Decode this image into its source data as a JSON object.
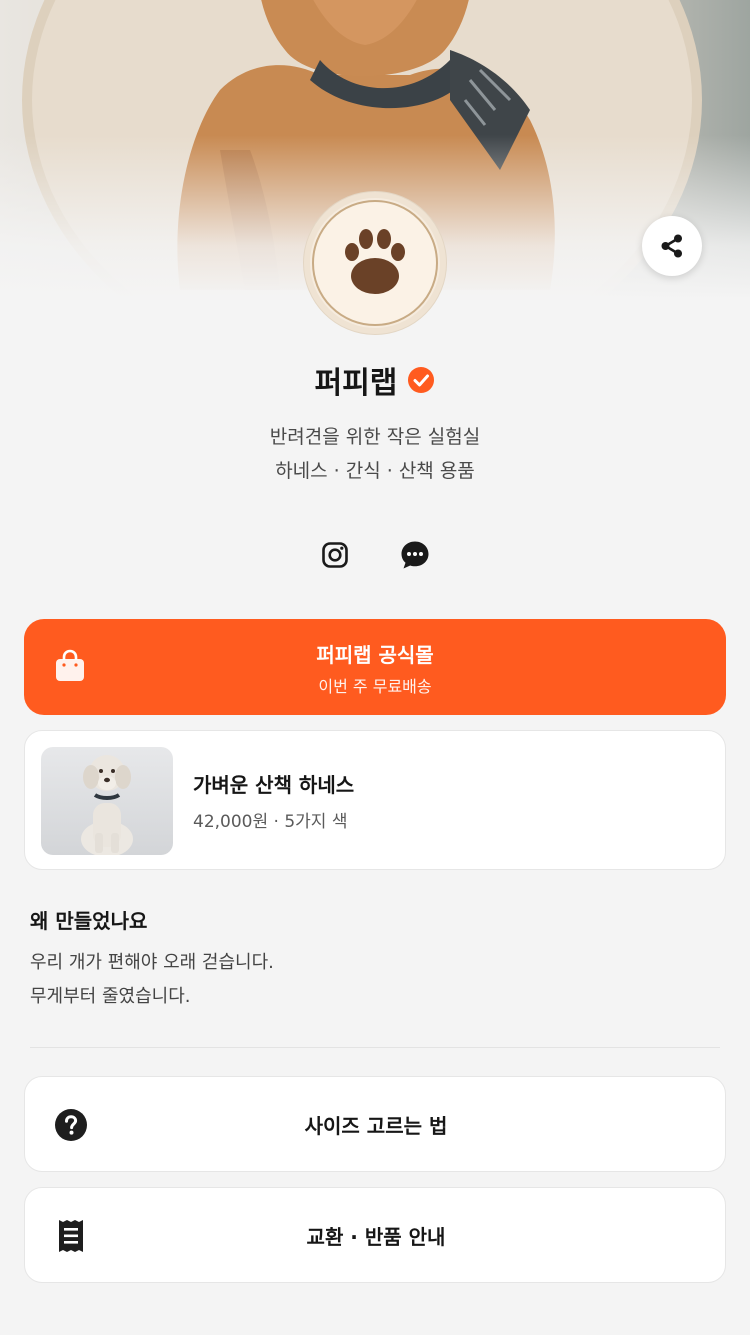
{
  "profile": {
    "name": "퍼피랩",
    "bio_line1": "반려견을 위한 작은 실험실",
    "bio_line2": "하네스 · 간식 · 산책 용품"
  },
  "icons": {
    "share": "share-icon",
    "verified": "verified-check-icon",
    "instagram": "instagram-icon",
    "chat": "chat-bubble-icon",
    "shop": "shopping-bag-icon",
    "help": "question-circle-icon",
    "receipt": "receipt-icon"
  },
  "colors": {
    "accent": "#ff5b1f",
    "background": "#f4f4f4",
    "card": "#ffffff"
  },
  "shop_button": {
    "title": "퍼피랩 공식몰",
    "subtitle": "이번 주 무료배송"
  },
  "product": {
    "title": "가벼운 산책 하네스",
    "meta": "42,000원 · 5가지 색"
  },
  "story": {
    "title": "왜 만들었나요",
    "line1": "우리 개가 편해야 오래 걷습니다.",
    "line2": "무게부터 줄였습니다."
  },
  "links": [
    {
      "label": "사이즈 고르는 법"
    },
    {
      "label": "교환 · 반품 안내"
    }
  ]
}
